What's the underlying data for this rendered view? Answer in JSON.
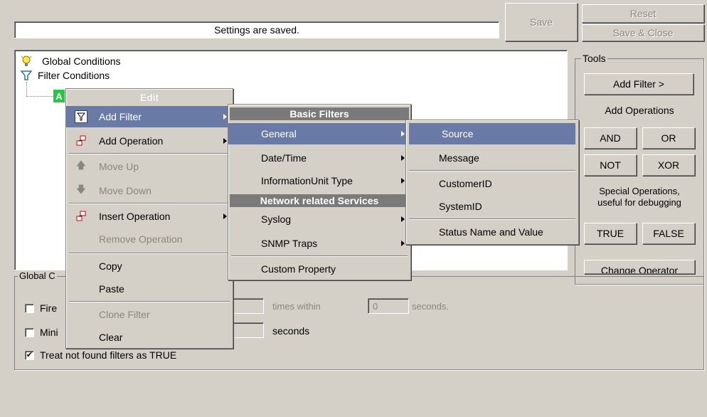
{
  "top": {
    "status_text": "Settings are saved.",
    "save_label": "Save",
    "reset_label": "Reset",
    "save_close_label": "Save & Close"
  },
  "tree": {
    "items": [
      {
        "label": "Global Conditions",
        "icon": "bulb-icon"
      },
      {
        "label": "Filter Conditions",
        "icon": "funnel-icon"
      },
      {
        "label": "A"
      }
    ]
  },
  "tools": {
    "title": "Tools",
    "add_filter_label": "Add Filter >",
    "add_operations_label": "Add Operations",
    "and_label": "AND",
    "or_label": "OR",
    "not_label": "NOT",
    "xor_label": "XOR",
    "special_line1": "Special Operations,",
    "special_line2": "useful for debugging",
    "true_label": "TRUE",
    "false_label": "FALSE",
    "change_operator_label": "Change Operator"
  },
  "global_options": {
    "title": "Global C",
    "fire_label": "Fire",
    "times_within_label": "times within",
    "seconds_value": "0",
    "seconds_label": "seconds.",
    "mini_label": "Mini",
    "seconds2_label": "seconds",
    "treat_label": "Treat not found filters as TRUE",
    "treat_checked": true
  },
  "context_menu": {
    "header": "Edit",
    "items": {
      "add_filter": "Add Filter",
      "add_operation": "Add Operation",
      "move_up": "Move Up",
      "move_down": "Move Down",
      "insert_operation": "Insert Operation",
      "remove_operation": "Remove Operation",
      "copy": "Copy",
      "paste": "Paste",
      "clone_filter": "Clone Filter",
      "clear": "Clear"
    }
  },
  "filters_menu": {
    "header_basic": "Basic Filters",
    "general": "General",
    "datetime": "Date/Time",
    "infounit": "InformationUnit Type",
    "header_network": "Network related Services",
    "syslog": "Syslog",
    "snmp": "SNMP Traps",
    "custom": "Custom Property"
  },
  "general_menu": {
    "source": "Source",
    "message": "Message",
    "customerid": "CustomerID",
    "systemid": "SystemID",
    "status_name_value": "Status Name and Value"
  },
  "colors": {
    "highlight": "#6a7aa6",
    "header_gray": "#7a7a7a",
    "face": "#d4d0c8"
  }
}
